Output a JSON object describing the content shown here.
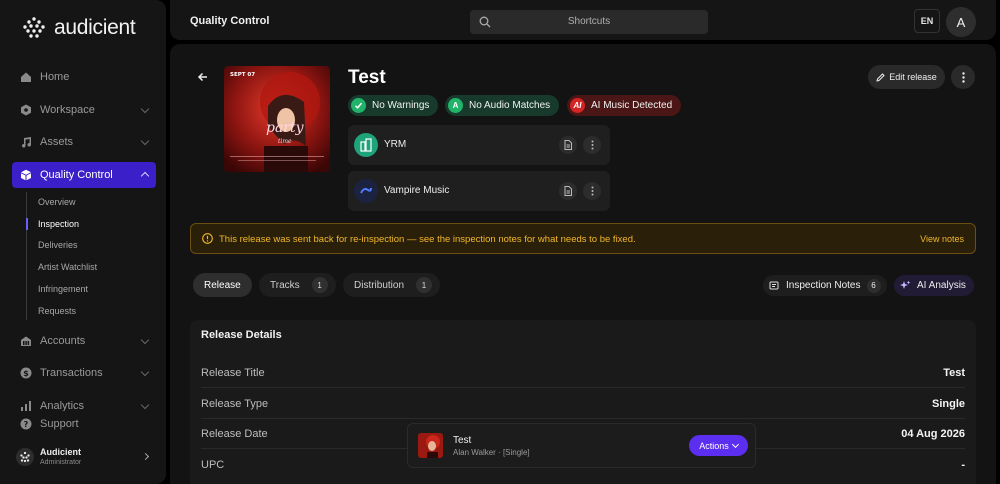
{
  "brand": {
    "name": "audicient"
  },
  "sidebar": {
    "items": [
      {
        "label": "Home",
        "icon": "home-icon",
        "has_chevron": false
      },
      {
        "label": "Workspace",
        "icon": "hexagon-icon",
        "has_chevron": true
      },
      {
        "label": "Assets",
        "icon": "music-note-icon",
        "has_chevron": true
      },
      {
        "label": "Quality Control",
        "icon": "cube-icon",
        "has_chevron": true,
        "active": true
      },
      {
        "label": "Accounts",
        "icon": "building-icon",
        "has_chevron": true
      },
      {
        "label": "Transactions",
        "icon": "dollar-icon",
        "has_chevron": true
      },
      {
        "label": "Analytics",
        "icon": "chart-icon",
        "has_chevron": true
      },
      {
        "label": "Support",
        "icon": "help-icon",
        "has_chevron": false
      }
    ],
    "subitems": [
      {
        "label": "Overview"
      },
      {
        "label": "Inspection",
        "active": true
      },
      {
        "label": "Deliveries"
      },
      {
        "label": "Artist Watchlist"
      },
      {
        "label": "Infringement"
      },
      {
        "label": "Requests"
      }
    ],
    "user": {
      "name": "Audicient",
      "role": "Administrator"
    }
  },
  "topbar": {
    "page_name": "Quality Control",
    "search_label": "Shortcuts",
    "language": "EN",
    "avatar_letter": "A"
  },
  "release": {
    "title": "Test",
    "cover_text": {
      "date": "SEPT 07",
      "script": "party",
      "sub": "time"
    },
    "badges": [
      {
        "label": "No Warnings",
        "kind": "green",
        "icon": "check-icon"
      },
      {
        "label": "No Audio Matches",
        "kind": "green",
        "icon": "A"
      },
      {
        "label": "AI Music Detected",
        "kind": "red",
        "icon": "AI"
      }
    ],
    "distributors": [
      {
        "name": "YRM",
        "logo": "yrm-building-icon"
      },
      {
        "name": "Vampire Music",
        "logo": "vampire-music-icon"
      }
    ],
    "edit_label": "Edit release"
  },
  "alert": {
    "text": "This release was sent back for re-inspection — see the inspection notes for what needs to be fixed.",
    "link": "View notes",
    "color": "#f2b82c"
  },
  "tabs": [
    {
      "label": "Release",
      "active": true
    },
    {
      "label": "Tracks",
      "count": "1"
    },
    {
      "label": "Distribution",
      "count": "1"
    }
  ],
  "actions": {
    "notes_label": "Inspection Notes",
    "notes_count": "6",
    "ai_label": "AI Analysis"
  },
  "details": {
    "heading": "Release Details",
    "rows": [
      {
        "key": "Release Title",
        "value": "Test"
      },
      {
        "key": "Release Type",
        "value": "Single"
      },
      {
        "key": "Release Date",
        "value": "04 Aug 2026"
      },
      {
        "key": "UPC",
        "value": "-"
      }
    ]
  },
  "player": {
    "title": "Test",
    "subtitle": "Alan Walker · [Single]",
    "actions_label": "Actions"
  },
  "colors": {
    "accent": "#5b2ef0",
    "active_nav": "#3b1fc9",
    "success": "#22b36a",
    "danger": "#d42424"
  }
}
